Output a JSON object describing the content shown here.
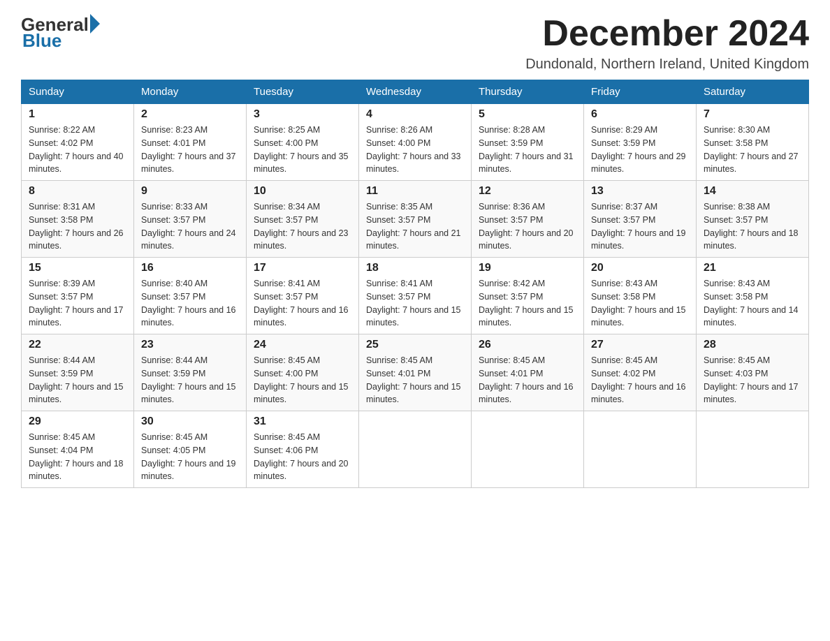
{
  "header": {
    "logo_general": "General",
    "logo_blue": "Blue",
    "month_title": "December 2024",
    "location": "Dundonald, Northern Ireland, United Kingdom"
  },
  "days_of_week": [
    "Sunday",
    "Monday",
    "Tuesday",
    "Wednesday",
    "Thursday",
    "Friday",
    "Saturday"
  ],
  "weeks": [
    [
      {
        "num": "1",
        "sunrise": "Sunrise: 8:22 AM",
        "sunset": "Sunset: 4:02 PM",
        "daylight": "Daylight: 7 hours and 40 minutes."
      },
      {
        "num": "2",
        "sunrise": "Sunrise: 8:23 AM",
        "sunset": "Sunset: 4:01 PM",
        "daylight": "Daylight: 7 hours and 37 minutes."
      },
      {
        "num": "3",
        "sunrise": "Sunrise: 8:25 AM",
        "sunset": "Sunset: 4:00 PM",
        "daylight": "Daylight: 7 hours and 35 minutes."
      },
      {
        "num": "4",
        "sunrise": "Sunrise: 8:26 AM",
        "sunset": "Sunset: 4:00 PM",
        "daylight": "Daylight: 7 hours and 33 minutes."
      },
      {
        "num": "5",
        "sunrise": "Sunrise: 8:28 AM",
        "sunset": "Sunset: 3:59 PM",
        "daylight": "Daylight: 7 hours and 31 minutes."
      },
      {
        "num": "6",
        "sunrise": "Sunrise: 8:29 AM",
        "sunset": "Sunset: 3:59 PM",
        "daylight": "Daylight: 7 hours and 29 minutes."
      },
      {
        "num": "7",
        "sunrise": "Sunrise: 8:30 AM",
        "sunset": "Sunset: 3:58 PM",
        "daylight": "Daylight: 7 hours and 27 minutes."
      }
    ],
    [
      {
        "num": "8",
        "sunrise": "Sunrise: 8:31 AM",
        "sunset": "Sunset: 3:58 PM",
        "daylight": "Daylight: 7 hours and 26 minutes."
      },
      {
        "num": "9",
        "sunrise": "Sunrise: 8:33 AM",
        "sunset": "Sunset: 3:57 PM",
        "daylight": "Daylight: 7 hours and 24 minutes."
      },
      {
        "num": "10",
        "sunrise": "Sunrise: 8:34 AM",
        "sunset": "Sunset: 3:57 PM",
        "daylight": "Daylight: 7 hours and 23 minutes."
      },
      {
        "num": "11",
        "sunrise": "Sunrise: 8:35 AM",
        "sunset": "Sunset: 3:57 PM",
        "daylight": "Daylight: 7 hours and 21 minutes."
      },
      {
        "num": "12",
        "sunrise": "Sunrise: 8:36 AM",
        "sunset": "Sunset: 3:57 PM",
        "daylight": "Daylight: 7 hours and 20 minutes."
      },
      {
        "num": "13",
        "sunrise": "Sunrise: 8:37 AM",
        "sunset": "Sunset: 3:57 PM",
        "daylight": "Daylight: 7 hours and 19 minutes."
      },
      {
        "num": "14",
        "sunrise": "Sunrise: 8:38 AM",
        "sunset": "Sunset: 3:57 PM",
        "daylight": "Daylight: 7 hours and 18 minutes."
      }
    ],
    [
      {
        "num": "15",
        "sunrise": "Sunrise: 8:39 AM",
        "sunset": "Sunset: 3:57 PM",
        "daylight": "Daylight: 7 hours and 17 minutes."
      },
      {
        "num": "16",
        "sunrise": "Sunrise: 8:40 AM",
        "sunset": "Sunset: 3:57 PM",
        "daylight": "Daylight: 7 hours and 16 minutes."
      },
      {
        "num": "17",
        "sunrise": "Sunrise: 8:41 AM",
        "sunset": "Sunset: 3:57 PM",
        "daylight": "Daylight: 7 hours and 16 minutes."
      },
      {
        "num": "18",
        "sunrise": "Sunrise: 8:41 AM",
        "sunset": "Sunset: 3:57 PM",
        "daylight": "Daylight: 7 hours and 15 minutes."
      },
      {
        "num": "19",
        "sunrise": "Sunrise: 8:42 AM",
        "sunset": "Sunset: 3:57 PM",
        "daylight": "Daylight: 7 hours and 15 minutes."
      },
      {
        "num": "20",
        "sunrise": "Sunrise: 8:43 AM",
        "sunset": "Sunset: 3:58 PM",
        "daylight": "Daylight: 7 hours and 15 minutes."
      },
      {
        "num": "21",
        "sunrise": "Sunrise: 8:43 AM",
        "sunset": "Sunset: 3:58 PM",
        "daylight": "Daylight: 7 hours and 14 minutes."
      }
    ],
    [
      {
        "num": "22",
        "sunrise": "Sunrise: 8:44 AM",
        "sunset": "Sunset: 3:59 PM",
        "daylight": "Daylight: 7 hours and 15 minutes."
      },
      {
        "num": "23",
        "sunrise": "Sunrise: 8:44 AM",
        "sunset": "Sunset: 3:59 PM",
        "daylight": "Daylight: 7 hours and 15 minutes."
      },
      {
        "num": "24",
        "sunrise": "Sunrise: 8:45 AM",
        "sunset": "Sunset: 4:00 PM",
        "daylight": "Daylight: 7 hours and 15 minutes."
      },
      {
        "num": "25",
        "sunrise": "Sunrise: 8:45 AM",
        "sunset": "Sunset: 4:01 PM",
        "daylight": "Daylight: 7 hours and 15 minutes."
      },
      {
        "num": "26",
        "sunrise": "Sunrise: 8:45 AM",
        "sunset": "Sunset: 4:01 PM",
        "daylight": "Daylight: 7 hours and 16 minutes."
      },
      {
        "num": "27",
        "sunrise": "Sunrise: 8:45 AM",
        "sunset": "Sunset: 4:02 PM",
        "daylight": "Daylight: 7 hours and 16 minutes."
      },
      {
        "num": "28",
        "sunrise": "Sunrise: 8:45 AM",
        "sunset": "Sunset: 4:03 PM",
        "daylight": "Daylight: 7 hours and 17 minutes."
      }
    ],
    [
      {
        "num": "29",
        "sunrise": "Sunrise: 8:45 AM",
        "sunset": "Sunset: 4:04 PM",
        "daylight": "Daylight: 7 hours and 18 minutes."
      },
      {
        "num": "30",
        "sunrise": "Sunrise: 8:45 AM",
        "sunset": "Sunset: 4:05 PM",
        "daylight": "Daylight: 7 hours and 19 minutes."
      },
      {
        "num": "31",
        "sunrise": "Sunrise: 8:45 AM",
        "sunset": "Sunset: 4:06 PM",
        "daylight": "Daylight: 7 hours and 20 minutes."
      },
      null,
      null,
      null,
      null
    ]
  ]
}
